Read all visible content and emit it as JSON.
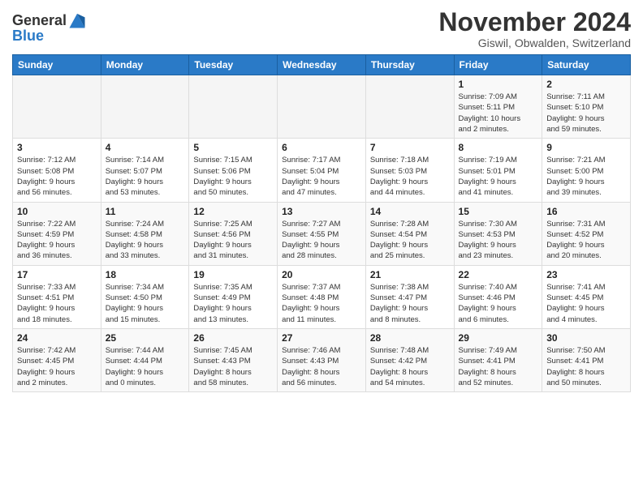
{
  "logo": {
    "line1": "General",
    "line2": "Blue"
  },
  "title": "November 2024",
  "location": "Giswil, Obwalden, Switzerland",
  "weekdays": [
    "Sunday",
    "Monday",
    "Tuesday",
    "Wednesday",
    "Thursday",
    "Friday",
    "Saturday"
  ],
  "weeks": [
    [
      {
        "day": "",
        "info": ""
      },
      {
        "day": "",
        "info": ""
      },
      {
        "day": "",
        "info": ""
      },
      {
        "day": "",
        "info": ""
      },
      {
        "day": "",
        "info": ""
      },
      {
        "day": "1",
        "info": "Sunrise: 7:09 AM\nSunset: 5:11 PM\nDaylight: 10 hours\nand 2 minutes."
      },
      {
        "day": "2",
        "info": "Sunrise: 7:11 AM\nSunset: 5:10 PM\nDaylight: 9 hours\nand 59 minutes."
      }
    ],
    [
      {
        "day": "3",
        "info": "Sunrise: 7:12 AM\nSunset: 5:08 PM\nDaylight: 9 hours\nand 56 minutes."
      },
      {
        "day": "4",
        "info": "Sunrise: 7:14 AM\nSunset: 5:07 PM\nDaylight: 9 hours\nand 53 minutes."
      },
      {
        "day": "5",
        "info": "Sunrise: 7:15 AM\nSunset: 5:06 PM\nDaylight: 9 hours\nand 50 minutes."
      },
      {
        "day": "6",
        "info": "Sunrise: 7:17 AM\nSunset: 5:04 PM\nDaylight: 9 hours\nand 47 minutes."
      },
      {
        "day": "7",
        "info": "Sunrise: 7:18 AM\nSunset: 5:03 PM\nDaylight: 9 hours\nand 44 minutes."
      },
      {
        "day": "8",
        "info": "Sunrise: 7:19 AM\nSunset: 5:01 PM\nDaylight: 9 hours\nand 41 minutes."
      },
      {
        "day": "9",
        "info": "Sunrise: 7:21 AM\nSunset: 5:00 PM\nDaylight: 9 hours\nand 39 minutes."
      }
    ],
    [
      {
        "day": "10",
        "info": "Sunrise: 7:22 AM\nSunset: 4:59 PM\nDaylight: 9 hours\nand 36 minutes."
      },
      {
        "day": "11",
        "info": "Sunrise: 7:24 AM\nSunset: 4:58 PM\nDaylight: 9 hours\nand 33 minutes."
      },
      {
        "day": "12",
        "info": "Sunrise: 7:25 AM\nSunset: 4:56 PM\nDaylight: 9 hours\nand 31 minutes."
      },
      {
        "day": "13",
        "info": "Sunrise: 7:27 AM\nSunset: 4:55 PM\nDaylight: 9 hours\nand 28 minutes."
      },
      {
        "day": "14",
        "info": "Sunrise: 7:28 AM\nSunset: 4:54 PM\nDaylight: 9 hours\nand 25 minutes."
      },
      {
        "day": "15",
        "info": "Sunrise: 7:30 AM\nSunset: 4:53 PM\nDaylight: 9 hours\nand 23 minutes."
      },
      {
        "day": "16",
        "info": "Sunrise: 7:31 AM\nSunset: 4:52 PM\nDaylight: 9 hours\nand 20 minutes."
      }
    ],
    [
      {
        "day": "17",
        "info": "Sunrise: 7:33 AM\nSunset: 4:51 PM\nDaylight: 9 hours\nand 18 minutes."
      },
      {
        "day": "18",
        "info": "Sunrise: 7:34 AM\nSunset: 4:50 PM\nDaylight: 9 hours\nand 15 minutes."
      },
      {
        "day": "19",
        "info": "Sunrise: 7:35 AM\nSunset: 4:49 PM\nDaylight: 9 hours\nand 13 minutes."
      },
      {
        "day": "20",
        "info": "Sunrise: 7:37 AM\nSunset: 4:48 PM\nDaylight: 9 hours\nand 11 minutes."
      },
      {
        "day": "21",
        "info": "Sunrise: 7:38 AM\nSunset: 4:47 PM\nDaylight: 9 hours\nand 8 minutes."
      },
      {
        "day": "22",
        "info": "Sunrise: 7:40 AM\nSunset: 4:46 PM\nDaylight: 9 hours\nand 6 minutes."
      },
      {
        "day": "23",
        "info": "Sunrise: 7:41 AM\nSunset: 4:45 PM\nDaylight: 9 hours\nand 4 minutes."
      }
    ],
    [
      {
        "day": "24",
        "info": "Sunrise: 7:42 AM\nSunset: 4:45 PM\nDaylight: 9 hours\nand 2 minutes."
      },
      {
        "day": "25",
        "info": "Sunrise: 7:44 AM\nSunset: 4:44 PM\nDaylight: 9 hours\nand 0 minutes."
      },
      {
        "day": "26",
        "info": "Sunrise: 7:45 AM\nSunset: 4:43 PM\nDaylight: 8 hours\nand 58 minutes."
      },
      {
        "day": "27",
        "info": "Sunrise: 7:46 AM\nSunset: 4:43 PM\nDaylight: 8 hours\nand 56 minutes."
      },
      {
        "day": "28",
        "info": "Sunrise: 7:48 AM\nSunset: 4:42 PM\nDaylight: 8 hours\nand 54 minutes."
      },
      {
        "day": "29",
        "info": "Sunrise: 7:49 AM\nSunset: 4:41 PM\nDaylight: 8 hours\nand 52 minutes."
      },
      {
        "day": "30",
        "info": "Sunrise: 7:50 AM\nSunset: 4:41 PM\nDaylight: 8 hours\nand 50 minutes."
      }
    ]
  ]
}
